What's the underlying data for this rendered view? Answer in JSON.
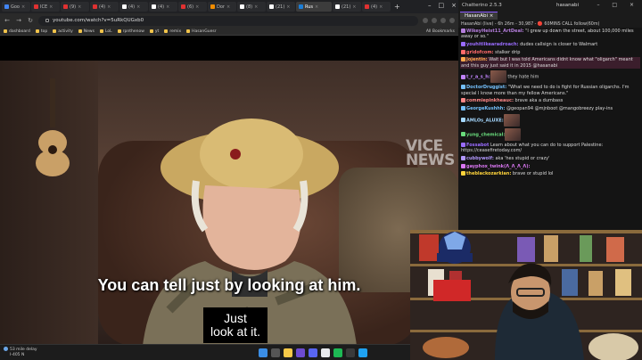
{
  "browser": {
    "tabs": [
      {
        "label": "Goo",
        "color": "#4285f4",
        "active": false
      },
      {
        "label": "ICE",
        "color": "#e03131",
        "active": false
      },
      {
        "label": "(9)",
        "color": "#e03131",
        "active": false
      },
      {
        "label": "(4)",
        "color": "#e03131",
        "active": false
      },
      {
        "label": "(4)",
        "color": "#ffffff",
        "active": false
      },
      {
        "label": "(4)",
        "color": "#ffffff",
        "active": false
      },
      {
        "label": "(6)",
        "color": "#e03131",
        "active": false
      },
      {
        "label": "Dor",
        "color": "#f08c00",
        "active": false
      },
      {
        "label": "(8)",
        "color": "#ffffff",
        "active": false
      },
      {
        "label": "(21)",
        "color": "#ffffff",
        "active": false
      },
      {
        "label": "Rus",
        "color": "#1c7ed6",
        "active": true
      },
      {
        "label": "(21)",
        "color": "#ffffff",
        "active": false
      },
      {
        "label": "(4)",
        "color": "#e03131",
        "active": false
      }
    ],
    "new_tab": "+",
    "url": "youtube.com/watch?v=5uRkQUGxb0",
    "bookmarks": [
      "dashboard",
      "top",
      "activity",
      "News",
      "LoL",
      "rpnthenow",
      "yt",
      "remix",
      "HasanGuesr"
    ],
    "all_bookmarks": "All Bookmarks"
  },
  "video": {
    "watermark_line1": "VICE",
    "watermark_line2": "NEWS",
    "subtitle_main": "You can tell just by looking at him.",
    "subtitle_line1": "Just",
    "subtitle_line2": "look at it."
  },
  "taskbar": {
    "weather_line1": "53 mile delay",
    "weather_line2": "I-405 N"
  },
  "chatterino": {
    "title": "Chatterino 2.5.3",
    "user": "hasanabi",
    "tab": "HasanAbi ×",
    "status": "HasanAbi (live) - 6h 26m - 30,987 - 🔴 60MINS CALL follow(60m)",
    "messages": [
      {
        "user": "WikeyHeist11_ArtDeal:",
        "ucolor": "#b57edc",
        "text": " \"I grew up down the street, about 100,000 miles away or so.\""
      },
      {
        "user": "youhitlikearadroach:",
        "ucolor": "#9a6cff",
        "text": " dudes callsign is closer to Walmart"
      },
      {
        "user": "gridofcom:",
        "ucolor": "#ff6b6b",
        "text": " stalker drip"
      },
      {
        "user": "Jojentin:",
        "ucolor": "#ffa94d",
        "text": " Wait but I was told Americans didnt know what \"oligarch\" meant and this guy just said it in 2015 @hasanabi",
        "hl": true
      },
      {
        "user": "t_r_a_s_h:",
        "ucolor": "#c084fc",
        "text": " they hate him",
        "emote": true
      },
      {
        "user": "DoctorDruggist:",
        "ucolor": "#74c0fc",
        "text": " \"What we need to do is fight for Russian oligarchs. I'm special I know more than my fellow Americans.\""
      },
      {
        "user": "commiepinkheauc:",
        "ucolor": "#ff8787",
        "text": " brave aka a dumbass"
      },
      {
        "user": "GeorgeKushhh:",
        "ucolor": "#74c0fc",
        "text": " @geopan94 @mjnboot @mangobreezy play-ins"
      },
      {
        "user": "AMLOs_ALUXE:",
        "ucolor": "#a5d8ff",
        "text": "",
        "emote": true
      },
      {
        "user": "yung_chemical:",
        "ucolor": "#69db7c",
        "text": "",
        "emote": true
      },
      {
        "user": "Fossabot",
        "ucolor": "#9a6cff",
        "text": " Learn about what you can do to support Palestine: https://ceasefiretoday.com/"
      },
      {
        "user": "cubbywolf:",
        "ucolor": "#b197fc",
        "text": " aka 'hes stupid or crazy'"
      },
      {
        "user": "gayphox_twink(Λ_Λ_Λ_Λ):",
        "ucolor": "#da77f2",
        "text": ""
      },
      {
        "user": "theblackozarkian:",
        "ucolor": "#ffd43b",
        "text": " brave or stupid lol"
      }
    ]
  },
  "colors": {
    "accent": "#8a59ff"
  }
}
